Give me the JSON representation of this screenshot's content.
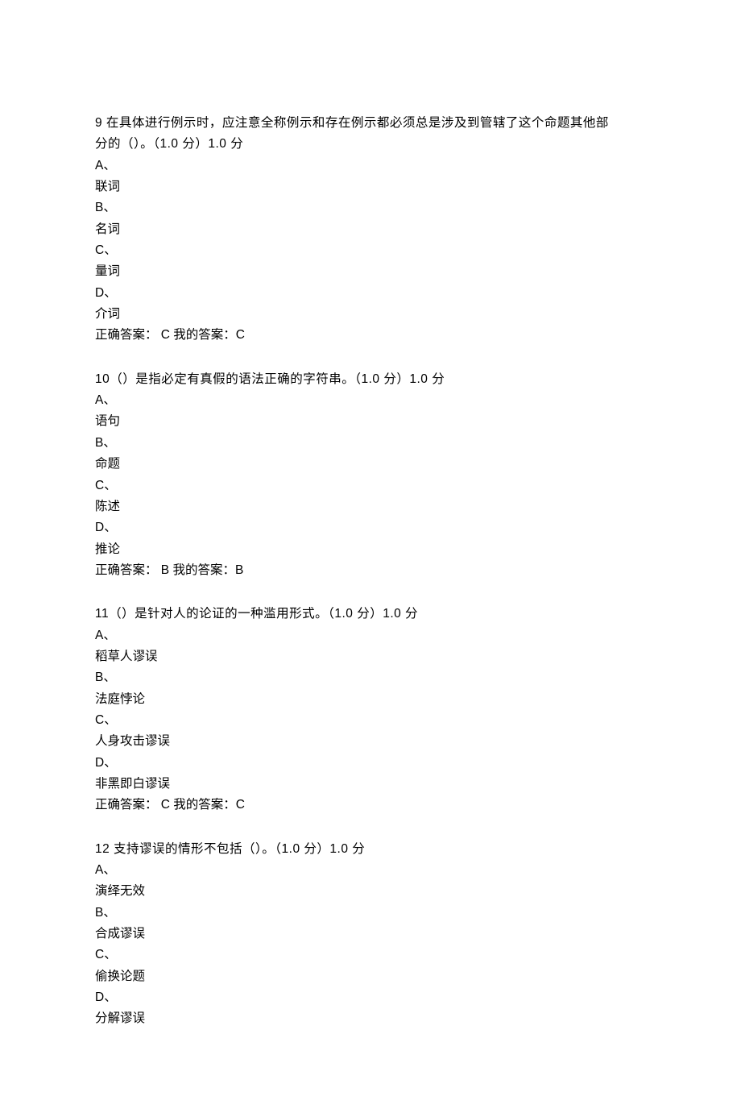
{
  "questions": [
    {
      "number": "9",
      "stem_part1": "9 在具体进行例示时，应注意全称例示和存在例示都必须总是涉及到管辖了这个命题其他部",
      "stem_part2": "分的（）。（1.0 分）1.0  分",
      "options": {
        "A_label": "A、",
        "A_text": "联词",
        "B_label": "B、",
        "B_text": "名词",
        "C_label": "C、",
        "C_text": "量词",
        "D_label": "D、",
        "D_text": "介词"
      },
      "answer_line": "正确答案：  C  我的答案：C"
    },
    {
      "number": "10",
      "stem_part1": "10（）是指必定有真假的语法正确的字符串。（1.0 分）1.0  分",
      "options": {
        "A_label": "A、",
        "A_text": "语句",
        "B_label": "B、",
        "B_text": "命题",
        "C_label": "C、",
        "C_text": "陈述",
        "D_label": "D、",
        "D_text": "推论"
      },
      "answer_line": "正确答案：  B  我的答案：B"
    },
    {
      "number": "11",
      "stem_part1": "11（）是针对人的论证的一种滥用形式。（1.0 分）1.0  分",
      "options": {
        "A_label": "A、",
        "A_text": "稻草人谬误",
        "B_label": "B、",
        "B_text": "法庭悖论",
        "C_label": "C、",
        "C_text": "人身攻击谬误",
        "D_label": "D、",
        "D_text": "非黑即白谬误"
      },
      "answer_line": "正确答案：  C  我的答案：C"
    },
    {
      "number": "12",
      "stem_part1": "12 支持谬误的情形不包括（）。（1.0 分）1.0  分",
      "options": {
        "A_label": "A、",
        "A_text": "演绎无效",
        "B_label": "B、",
        "B_text": "合成谬误",
        "C_label": "C、",
        "C_text": "偷换论题",
        "D_label": "D、",
        "D_text": "分解谬误"
      }
    }
  ]
}
